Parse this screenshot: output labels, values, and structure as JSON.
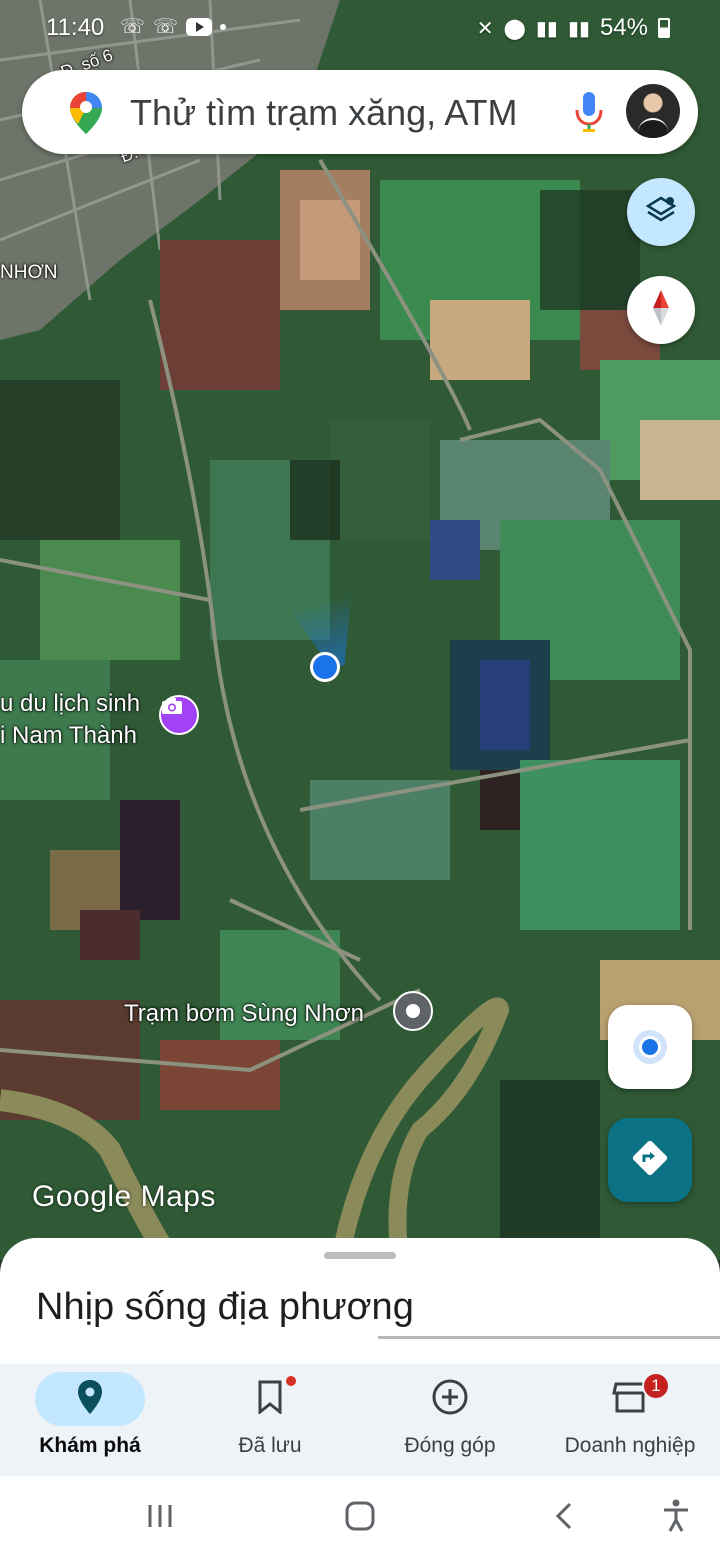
{
  "status_bar": {
    "time": "11:40",
    "battery": "54%"
  },
  "search": {
    "placeholder": "Thử tìm trạm xăng, ATM"
  },
  "map": {
    "labels": {
      "district": "NHƠN",
      "poi_tourism_line1": "u du lịch sinh",
      "poi_tourism_line2": "i Nam Thành",
      "pump_station": "Trạm bơm Sùng Nhơn",
      "road_1": "Đ. số 6",
      "road_2": "Đ. Kai"
    },
    "watermark": "Google Maps"
  },
  "sheet": {
    "title": "Nhịp sống địa phương"
  },
  "bottom_nav": {
    "items": [
      {
        "label": "Khám phá",
        "icon": "location-pin-icon",
        "active": true
      },
      {
        "label": "Đã lưu",
        "icon": "bookmark-icon",
        "active": false
      },
      {
        "label": "Đóng góp",
        "icon": "add-circle-icon",
        "active": false
      },
      {
        "label": "Doanh nghiệp",
        "icon": "storefront-icon",
        "active": false,
        "badge": "1"
      }
    ]
  },
  "colors": {
    "accent": "#1a73e8",
    "active_nav_bg": "#c2e7ff",
    "directions_bg": "#0b7285",
    "badge": "#c5221f"
  }
}
